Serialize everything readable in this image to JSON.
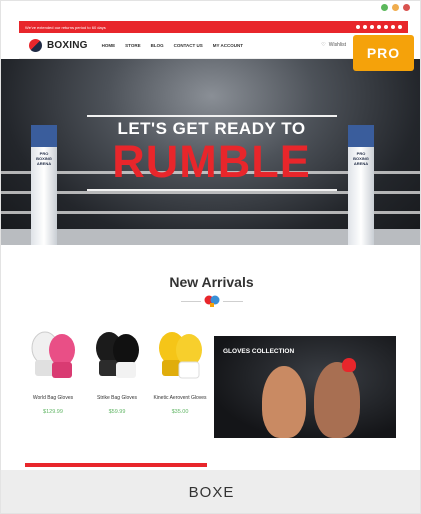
{
  "window": {
    "controls": [
      {
        "name": "green",
        "color": "#5cb85c"
      },
      {
        "name": "orange",
        "color": "#f0ad4e"
      },
      {
        "name": "red",
        "color": "#d9534f"
      }
    ]
  },
  "topbar": {
    "notice": "We've extended our returns period to 60 days",
    "social_icons": [
      "twitter-icon",
      "facebook-icon",
      "pinterest-icon",
      "instagram-icon",
      "dribbble-icon",
      "youtube-icon",
      "email-icon"
    ]
  },
  "nav": {
    "logo": "BOXING",
    "menu": [
      "HOME",
      "STORE",
      "BLOG",
      "CONTACT US",
      "MY ACCOUNT"
    ],
    "wishlist": "Wishlist"
  },
  "badge": {
    "label": "PRO",
    "color": "#f5a20a"
  },
  "hero": {
    "subtitle": "LET'S GET READY TO",
    "title": "RUMBLE",
    "post_left": "PRO BOXING ARENA",
    "post_right": "PRO BOXING ARENA"
  },
  "section": {
    "title": "New Arrivals"
  },
  "products": [
    {
      "name": "World Bag Gloves",
      "price": "$129.99",
      "colors": [
        "#f2f2f2",
        "#e94f86"
      ]
    },
    {
      "name": "Strike Bag Gloves",
      "price": "$59.99",
      "colors": [
        "#1b1b1b",
        "#f2f2f2"
      ]
    },
    {
      "name": "Kinetic Aerovent Gloves",
      "price": "$35.00",
      "colors": [
        "#f5c518",
        "#ffffff"
      ]
    }
  ],
  "collection": {
    "title": "GLOVES COLLECTION"
  },
  "footer": {
    "theme_name": "BOXE"
  },
  "colors": {
    "accent": "#e8262b",
    "price": "#5fb563"
  }
}
